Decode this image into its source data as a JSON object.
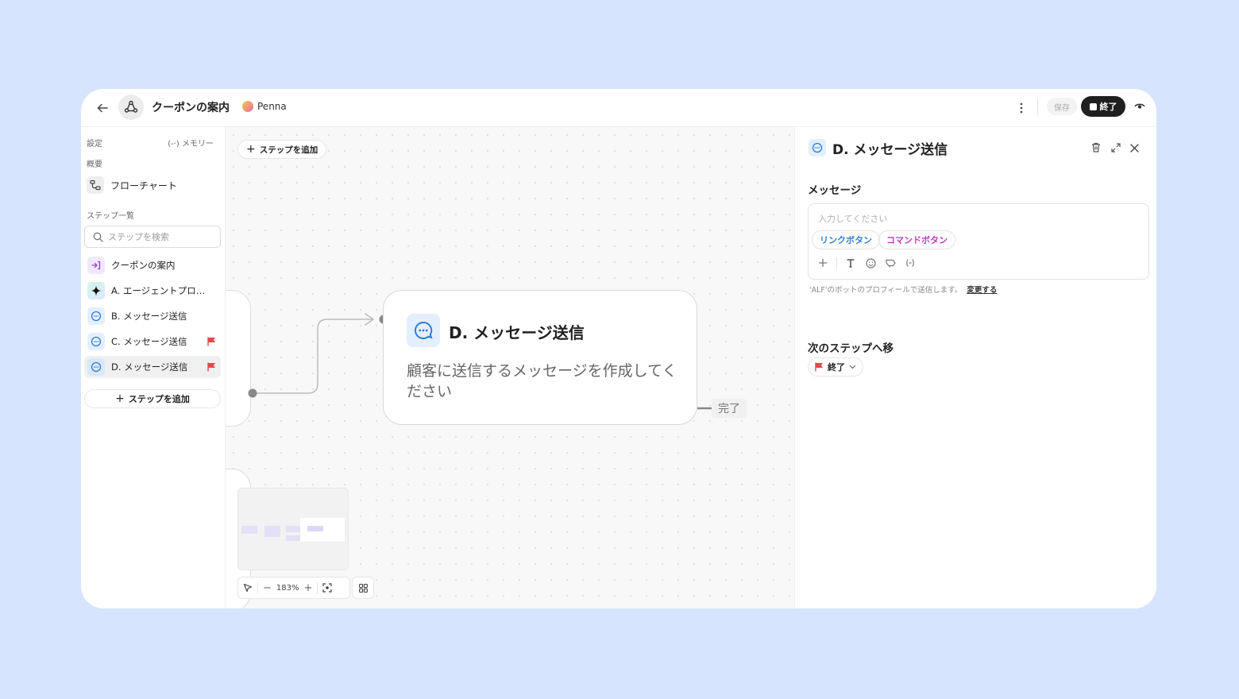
{
  "header": {
    "title": "クーポンの案内",
    "persona": "Penna",
    "save_label": "保存",
    "end_label": "終了"
  },
  "sidebar": {
    "settings_label": "設定",
    "memory_label": "(-·) メモリー",
    "overview_label": "概要",
    "flowchart_label": "フローチャート",
    "steps_label": "ステップ一覧",
    "search_placeholder": "ステップを検索",
    "steps": [
      {
        "label": "クーポンの案内",
        "icon": "entry-icon",
        "flag": false,
        "active": false
      },
      {
        "label": "A. エージェントプロンプト",
        "icon": "sparkle-icon",
        "flag": false,
        "active": false
      },
      {
        "label": "B. メッセージ送信",
        "icon": "message-icon",
        "flag": false,
        "active": false
      },
      {
        "label": "C. メッセージ送信",
        "icon": "message-icon",
        "flag": true,
        "active": false
      },
      {
        "label": "D. メッセージ送信",
        "icon": "message-icon",
        "flag": true,
        "active": true
      }
    ],
    "add_step_label": "ステップを追加"
  },
  "canvas": {
    "add_step_label": "ステップを追加",
    "card": {
      "title": "D. メッセージ送信",
      "description": "顧客に送信するメッセージを作成してください"
    },
    "done_label": "完了",
    "zoom": "183%"
  },
  "panel": {
    "title": "D. メッセージ送信",
    "message_label": "メッセージ",
    "message_placeholder": "入力してください",
    "chips": {
      "link": "リンクボタン",
      "command": "コマンドボタン"
    },
    "bot_note": "'ALF'のボットのプロフィールで送信します。",
    "change_label": "変更する",
    "next_step_label": "次のステップへ移",
    "next_step_value": "終了"
  },
  "colors": {
    "background": "#d6e4fd",
    "accent_blue": "#2f7ed6",
    "command_magenta": "#c53bb8",
    "flag_red": "#e5484d",
    "dark_button": "#1f1f1f"
  }
}
